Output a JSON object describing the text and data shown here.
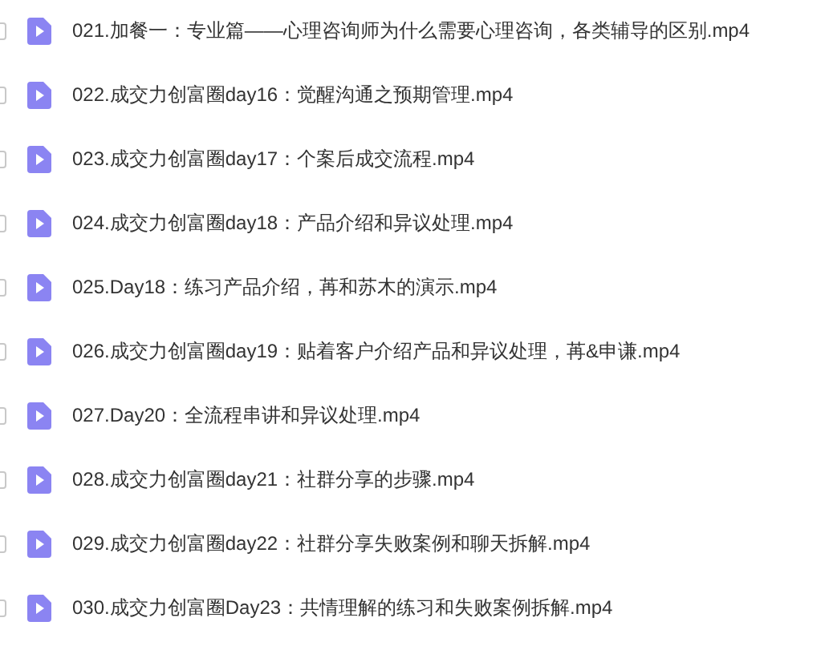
{
  "files": [
    {
      "name": "021.加餐一：专业篇——心理咨询师为什么需要心理咨询，各类辅导的区别.mp4",
      "checked": false
    },
    {
      "name": "022.成交力创富圈day16：觉醒沟通之预期管理.mp4",
      "checked": false
    },
    {
      "name": "023.成交力创富圈day17：个案后成交流程.mp4",
      "checked": false
    },
    {
      "name": "024.成交力创富圈day18：产品介绍和异议处理.mp4",
      "checked": false
    },
    {
      "name": "025.Day18：练习产品介绍，苒和苏木的演示.mp4",
      "checked": false
    },
    {
      "name": "026.成交力创富圈day19：贴着客户介绍产品和异议处理，苒&申谦.mp4",
      "checked": false
    },
    {
      "name": "027.Day20：全流程串讲和异议处理.mp4",
      "checked": false
    },
    {
      "name": "028.成交力创富圈day21：社群分享的步骤.mp4",
      "checked": false
    },
    {
      "name": "029.成交力创富圈day22：社群分享失败案例和聊天拆解.mp4",
      "checked": false
    },
    {
      "name": "030.成交力创富圈Day23：共情理解的练习和失败案例拆解.mp4",
      "checked": false
    }
  ]
}
